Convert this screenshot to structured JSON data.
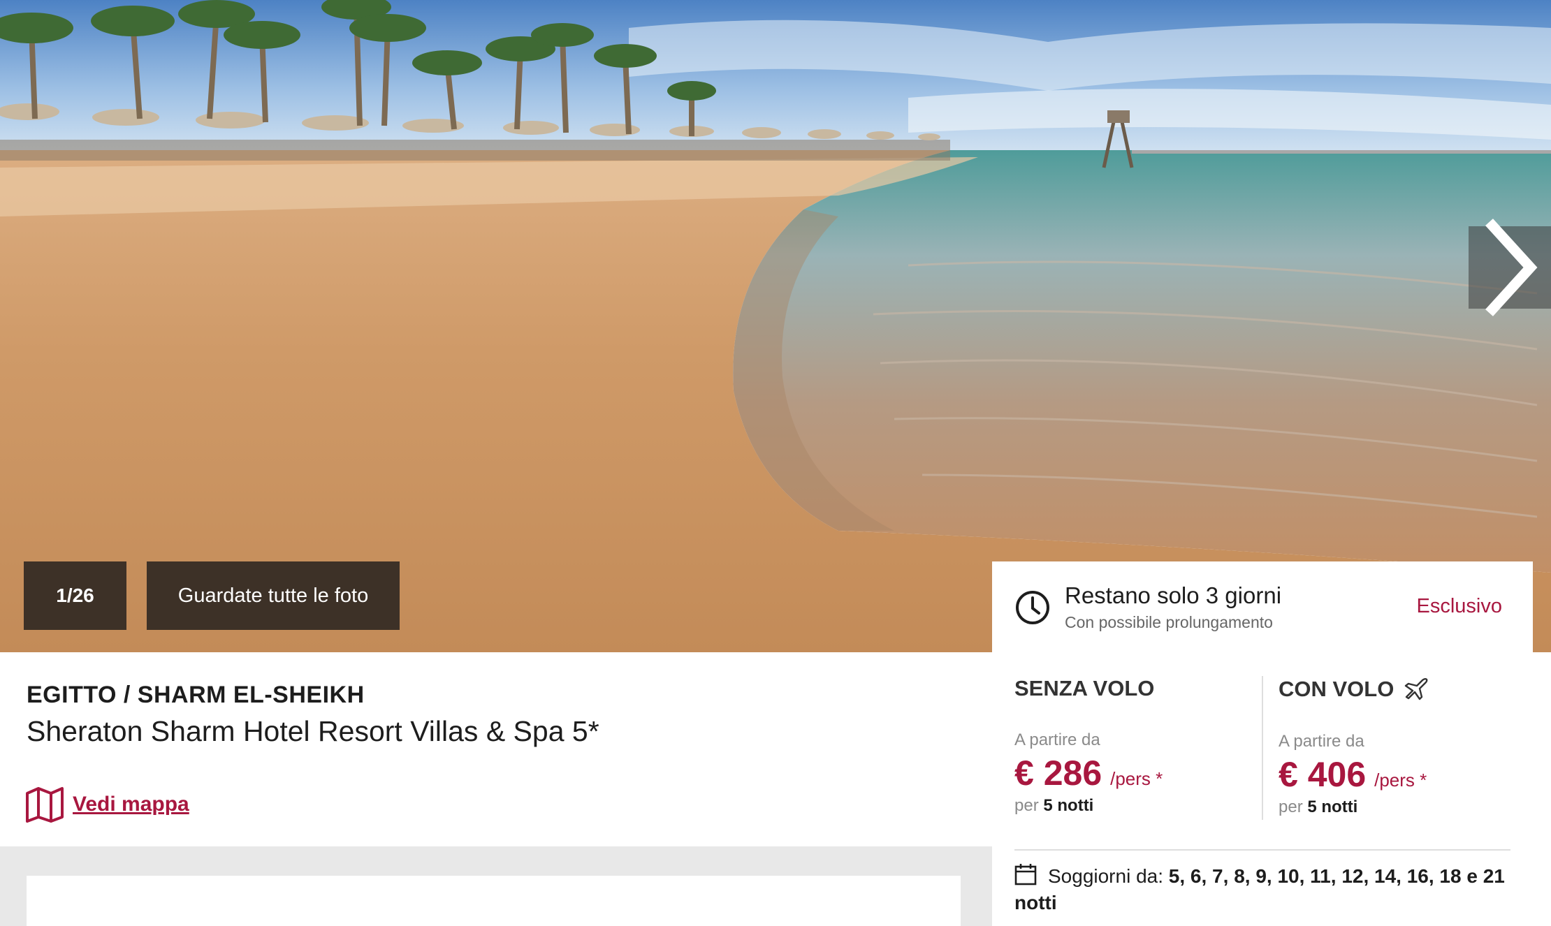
{
  "gallery": {
    "counter": "1/26",
    "all_photos_label": "Guardate tutte le foto",
    "next_icon": "chevron-right-icon"
  },
  "hotel": {
    "destination": "EGITTO / SHARM EL-SHEIKH",
    "name": "Sheraton Sharm Hotel Resort Villas & Spa 5*",
    "map_label": "Vedi mappa",
    "map_icon": "map-icon"
  },
  "offer": {
    "remaining_title": "Restano solo 3 giorni",
    "remaining_sub": "Con possibile prolungamento",
    "exclusive_label": "Esclusivo",
    "clock_icon": "clock-icon"
  },
  "pricing": {
    "without_flight": {
      "title": "SENZA VOLO",
      "from_label": "A partire da",
      "price": "€ 286",
      "unit": "/pers *",
      "per_label": "per",
      "nights": "5 notti"
    },
    "with_flight": {
      "title": "CON VOLO",
      "icon": "airplane-icon",
      "from_label": "A partire da",
      "price": "€ 406",
      "unit": "/pers *",
      "per_label": "per",
      "nights": "5 notti"
    }
  },
  "stays": {
    "label": "Soggiorni da:",
    "values": "5, 6, 7, 8, 9, 10, 11, 12, 14, 16, 18 e 21 notti",
    "icon": "calendar-icon"
  },
  "colors": {
    "accent": "#a8173f",
    "button_bg": "#3d3127",
    "band_gray": "#e8e8e8"
  }
}
